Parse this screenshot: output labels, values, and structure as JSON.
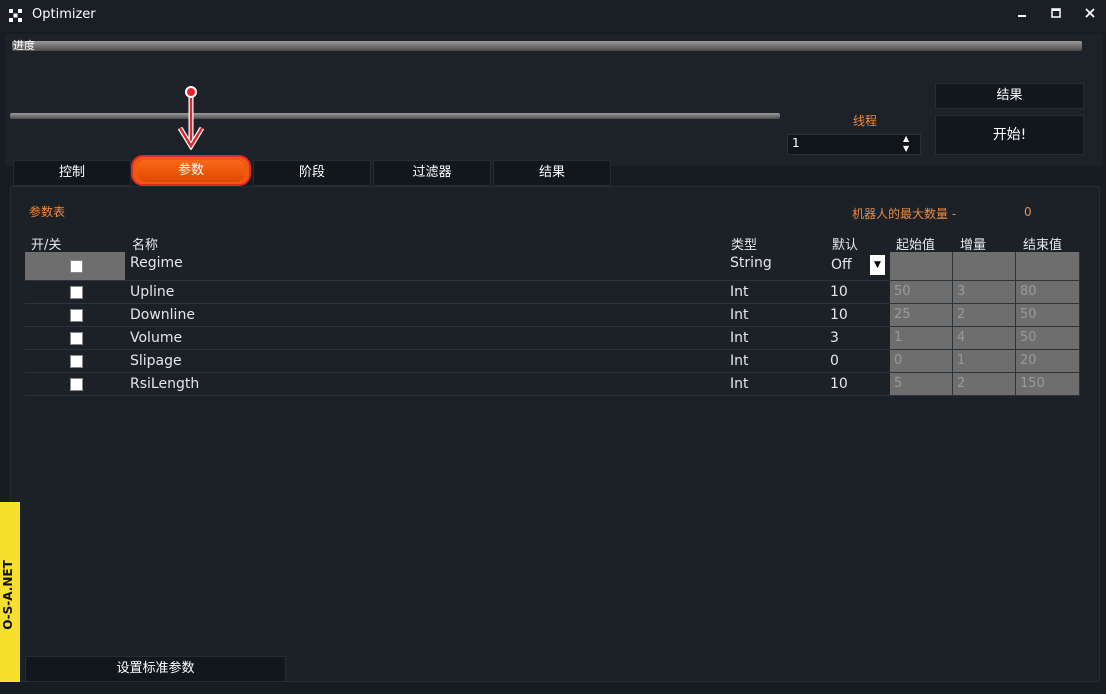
{
  "window": {
    "title": "Optimizer",
    "minimize_icon": "minimize-icon",
    "maximize_icon": "maximize-icon",
    "close_icon": "close-icon"
  },
  "progress": {
    "label": "进度"
  },
  "threads": {
    "label": "线程",
    "value": "1"
  },
  "buttons": {
    "results": "结果",
    "start": "开始!",
    "set_standard_params": "设置标准参数"
  },
  "tabs": [
    {
      "label": "控制",
      "active": false
    },
    {
      "label": "参数",
      "active": true
    },
    {
      "label": "阶段",
      "active": false
    },
    {
      "label": "过滤器",
      "active": false
    },
    {
      "label": "结果",
      "active": false
    }
  ],
  "params_panel": {
    "title": "参数表",
    "robots_label": "机器人的最大数量 -",
    "robots_value": "0",
    "columns": [
      "开/关",
      "名称",
      "类型",
      "默认",
      "起始值",
      "增量",
      "结束值"
    ],
    "rows": [
      {
        "name": "Regime",
        "type": "String",
        "default": "Off",
        "start": "",
        "step": "",
        "end": "",
        "has_dropdown": true
      },
      {
        "name": "Upline",
        "type": "Int",
        "default": "10",
        "start": "50",
        "step": "3",
        "end": "80"
      },
      {
        "name": "Downline",
        "type": "Int",
        "default": "10",
        "start": "25",
        "step": "2",
        "end": "50"
      },
      {
        "name": "Volume",
        "type": "Int",
        "default": "3",
        "start": "1",
        "step": "4",
        "end": "50"
      },
      {
        "name": "Slipage",
        "type": "Int",
        "default": "0",
        "start": "0",
        "step": "1",
        "end": "20"
      },
      {
        "name": "RsiLength",
        "type": "Int",
        "default": "10",
        "start": "5",
        "step": "2",
        "end": "150"
      }
    ]
  },
  "watermark": {
    "text": "O-S-A.NET"
  },
  "colors": {
    "accent": "#f08a3c",
    "active_tab": "#f05a10",
    "background": "#171c22"
  }
}
